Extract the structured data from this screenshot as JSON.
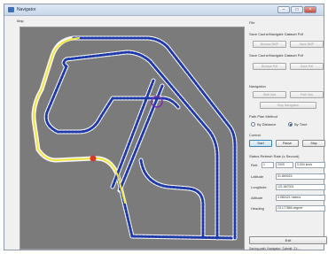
{
  "window": {
    "title": "Navigator"
  },
  "map": {
    "label": "Map",
    "colors": {
      "background": "#7b7b7b",
      "road_border": "#f7f7f7",
      "path_dots": "#1f3aa8",
      "active_route": "#f2e53a",
      "vehicle": "#d43a2a",
      "target": "#7a2fb0"
    }
  },
  "panel": {
    "file_label": "File",
    "cache_label": "Save Cache/Navigate Dataset Pdf",
    "cache_buttons": [
      "Browse BMP",
      "Save BMP"
    ],
    "load_label": "Save Cache/Navigate Dataset Pdf",
    "load_buttons": [
      "Browse Pdf",
      "Save Pdf"
    ],
    "navigation_label": "Navigation",
    "nav_buttons": [
      "Start Nav",
      "Path Nav"
    ],
    "nav_wide_button": "Stop Navigation",
    "method_label": "Path Plan Method",
    "methods": [
      {
        "label": "By Distance",
        "selected": false
      },
      {
        "label": "By Time",
        "selected": true
      }
    ],
    "control_label": "Control",
    "control_buttons": [
      "Start",
      "Pause",
      "Stop"
    ],
    "status_label": "Status Refresh Rate (s Second)",
    "rate": {
      "label": "Refr.",
      "value": "1",
      "value2": "2000",
      "value3": "0.004 km/s"
    },
    "fields": [
      {
        "label": "Latitude",
        "value": "31.869024"
      },
      {
        "label": "Longitude",
        "value": "121.667001"
      },
      {
        "label": "Altitude",
        "value": "3.980421 meters"
      },
      {
        "label": "Heading",
        "value": "23.177856 degree"
      }
    ],
    "exit_label": "Exit",
    "status_text": "Saving path: Navigator: Submit: 21:..."
  }
}
